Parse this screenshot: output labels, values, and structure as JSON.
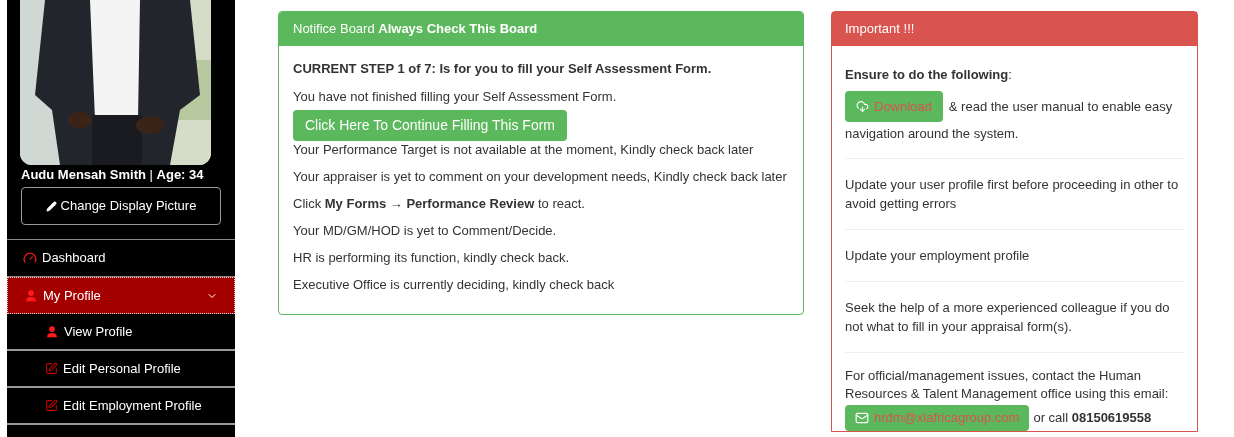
{
  "sidebar": {
    "profile_line": "**Audu Mensah Smith** | **Age: 34**",
    "change_picture_button": "Change Display Picture",
    "nav": [
      {
        "label": "Dashboard",
        "kind": "dashboard",
        "selected": false
      },
      {
        "label": "My Profile",
        "kind": "profile",
        "selected": true,
        "expanded": true,
        "children": [
          {
            "label": "View Profile",
            "kind": "profile"
          },
          {
            "label": "Edit Personal Profile",
            "kind": "edit"
          },
          {
            "label": "Edit Employment Profile",
            "kind": "edit"
          }
        ]
      }
    ]
  },
  "notice_board": {
    "title": "Notifice Board **Always Check This Board**",
    "lines": [
      {
        "kind": "heading",
        "text": "CURRENT STEP 1 of 7: Is for you to fill your Self Assessment Form."
      },
      {
        "kind": "text",
        "text": "You have not finished filling your Self Assessment Form."
      },
      {
        "kind": "button",
        "text": "Click Here To Continue Filling This Form"
      },
      {
        "kind": "text",
        "text": "Your Performance Target is not available at the moment, Kindly check back later"
      },
      {
        "kind": "text",
        "text": "Your appraiser is yet to comment on your development needs, Kindly check back later"
      },
      {
        "kind": "text",
        "text": "Click **My Forms → Performance Review** to react."
      },
      {
        "kind": "text",
        "text": "Your MD/GM/HOD is yet to Comment/Decide."
      },
      {
        "kind": "text",
        "text": "HR is performing its function, kindly check back."
      },
      {
        "kind": "text",
        "text": "Executive Office is currently deciding, kindly check back"
      }
    ]
  },
  "important": {
    "title": "Important !!!",
    "intro": "**Ensure to do the following**:",
    "download_button": "Download",
    "download_text": "& read the user manual to enable easy",
    "download_text_continued": "navigation around the system.",
    "items": [
      "Update your user profile first before proceeding in other to avoid getting errors",
      "Update your employment profile",
      "Seek the help of a more experienced colleague if you do not what to fill in your appraisal form(s)."
    ],
    "contact_text": "For official/management issues, contact the Human Resources & Talent Management office using this email:",
    "email_button": "hrdm@xlafricagroup.com",
    "call_text": "or call **08150619558**"
  }
}
